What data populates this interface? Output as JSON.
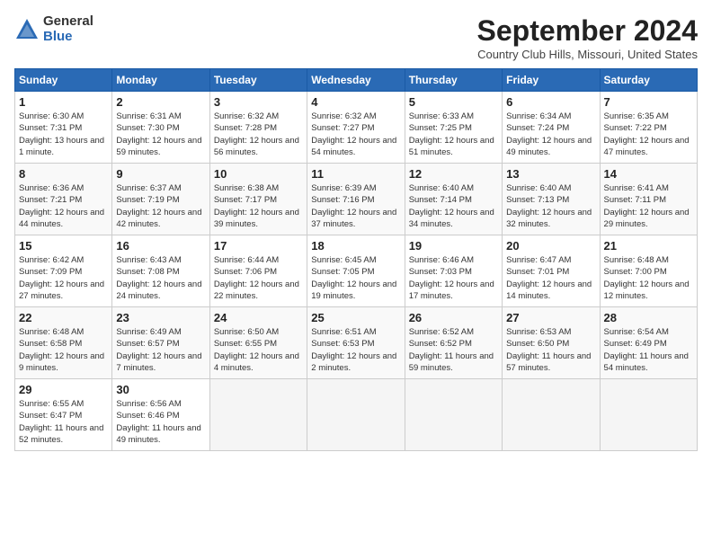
{
  "logo": {
    "general": "General",
    "blue": "Blue"
  },
  "title": "September 2024",
  "location": "Country Club Hills, Missouri, United States",
  "weekdays": [
    "Sunday",
    "Monday",
    "Tuesday",
    "Wednesday",
    "Thursday",
    "Friday",
    "Saturday"
  ],
  "weeks": [
    [
      {
        "day": "1",
        "sunrise": "Sunrise: 6:30 AM",
        "sunset": "Sunset: 7:31 PM",
        "daylight": "Daylight: 13 hours and 1 minute."
      },
      {
        "day": "2",
        "sunrise": "Sunrise: 6:31 AM",
        "sunset": "Sunset: 7:30 PM",
        "daylight": "Daylight: 12 hours and 59 minutes."
      },
      {
        "day": "3",
        "sunrise": "Sunrise: 6:32 AM",
        "sunset": "Sunset: 7:28 PM",
        "daylight": "Daylight: 12 hours and 56 minutes."
      },
      {
        "day": "4",
        "sunrise": "Sunrise: 6:32 AM",
        "sunset": "Sunset: 7:27 PM",
        "daylight": "Daylight: 12 hours and 54 minutes."
      },
      {
        "day": "5",
        "sunrise": "Sunrise: 6:33 AM",
        "sunset": "Sunset: 7:25 PM",
        "daylight": "Daylight: 12 hours and 51 minutes."
      },
      {
        "day": "6",
        "sunrise": "Sunrise: 6:34 AM",
        "sunset": "Sunset: 7:24 PM",
        "daylight": "Daylight: 12 hours and 49 minutes."
      },
      {
        "day": "7",
        "sunrise": "Sunrise: 6:35 AM",
        "sunset": "Sunset: 7:22 PM",
        "daylight": "Daylight: 12 hours and 47 minutes."
      }
    ],
    [
      {
        "day": "8",
        "sunrise": "Sunrise: 6:36 AM",
        "sunset": "Sunset: 7:21 PM",
        "daylight": "Daylight: 12 hours and 44 minutes."
      },
      {
        "day": "9",
        "sunrise": "Sunrise: 6:37 AM",
        "sunset": "Sunset: 7:19 PM",
        "daylight": "Daylight: 12 hours and 42 minutes."
      },
      {
        "day": "10",
        "sunrise": "Sunrise: 6:38 AM",
        "sunset": "Sunset: 7:17 PM",
        "daylight": "Daylight: 12 hours and 39 minutes."
      },
      {
        "day": "11",
        "sunrise": "Sunrise: 6:39 AM",
        "sunset": "Sunset: 7:16 PM",
        "daylight": "Daylight: 12 hours and 37 minutes."
      },
      {
        "day": "12",
        "sunrise": "Sunrise: 6:40 AM",
        "sunset": "Sunset: 7:14 PM",
        "daylight": "Daylight: 12 hours and 34 minutes."
      },
      {
        "day": "13",
        "sunrise": "Sunrise: 6:40 AM",
        "sunset": "Sunset: 7:13 PM",
        "daylight": "Daylight: 12 hours and 32 minutes."
      },
      {
        "day": "14",
        "sunrise": "Sunrise: 6:41 AM",
        "sunset": "Sunset: 7:11 PM",
        "daylight": "Daylight: 12 hours and 29 minutes."
      }
    ],
    [
      {
        "day": "15",
        "sunrise": "Sunrise: 6:42 AM",
        "sunset": "Sunset: 7:09 PM",
        "daylight": "Daylight: 12 hours and 27 minutes."
      },
      {
        "day": "16",
        "sunrise": "Sunrise: 6:43 AM",
        "sunset": "Sunset: 7:08 PM",
        "daylight": "Daylight: 12 hours and 24 minutes."
      },
      {
        "day": "17",
        "sunrise": "Sunrise: 6:44 AM",
        "sunset": "Sunset: 7:06 PM",
        "daylight": "Daylight: 12 hours and 22 minutes."
      },
      {
        "day": "18",
        "sunrise": "Sunrise: 6:45 AM",
        "sunset": "Sunset: 7:05 PM",
        "daylight": "Daylight: 12 hours and 19 minutes."
      },
      {
        "day": "19",
        "sunrise": "Sunrise: 6:46 AM",
        "sunset": "Sunset: 7:03 PM",
        "daylight": "Daylight: 12 hours and 17 minutes."
      },
      {
        "day": "20",
        "sunrise": "Sunrise: 6:47 AM",
        "sunset": "Sunset: 7:01 PM",
        "daylight": "Daylight: 12 hours and 14 minutes."
      },
      {
        "day": "21",
        "sunrise": "Sunrise: 6:48 AM",
        "sunset": "Sunset: 7:00 PM",
        "daylight": "Daylight: 12 hours and 12 minutes."
      }
    ],
    [
      {
        "day": "22",
        "sunrise": "Sunrise: 6:48 AM",
        "sunset": "Sunset: 6:58 PM",
        "daylight": "Daylight: 12 hours and 9 minutes."
      },
      {
        "day": "23",
        "sunrise": "Sunrise: 6:49 AM",
        "sunset": "Sunset: 6:57 PM",
        "daylight": "Daylight: 12 hours and 7 minutes."
      },
      {
        "day": "24",
        "sunrise": "Sunrise: 6:50 AM",
        "sunset": "Sunset: 6:55 PM",
        "daylight": "Daylight: 12 hours and 4 minutes."
      },
      {
        "day": "25",
        "sunrise": "Sunrise: 6:51 AM",
        "sunset": "Sunset: 6:53 PM",
        "daylight": "Daylight: 12 hours and 2 minutes."
      },
      {
        "day": "26",
        "sunrise": "Sunrise: 6:52 AM",
        "sunset": "Sunset: 6:52 PM",
        "daylight": "Daylight: 11 hours and 59 minutes."
      },
      {
        "day": "27",
        "sunrise": "Sunrise: 6:53 AM",
        "sunset": "Sunset: 6:50 PM",
        "daylight": "Daylight: 11 hours and 57 minutes."
      },
      {
        "day": "28",
        "sunrise": "Sunrise: 6:54 AM",
        "sunset": "Sunset: 6:49 PM",
        "daylight": "Daylight: 11 hours and 54 minutes."
      }
    ],
    [
      {
        "day": "29",
        "sunrise": "Sunrise: 6:55 AM",
        "sunset": "Sunset: 6:47 PM",
        "daylight": "Daylight: 11 hours and 52 minutes."
      },
      {
        "day": "30",
        "sunrise": "Sunrise: 6:56 AM",
        "sunset": "Sunset: 6:46 PM",
        "daylight": "Daylight: 11 hours and 49 minutes."
      },
      null,
      null,
      null,
      null,
      null
    ]
  ]
}
